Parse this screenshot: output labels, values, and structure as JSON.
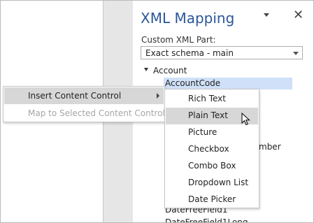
{
  "pane": {
    "title": "XML Mapping",
    "field_label": "Custom XML Part:",
    "selected_part": "Exact schema - main"
  },
  "tree": {
    "root": "Account",
    "selected": "AccountCode",
    "partial_member": "mber",
    "item_a": "DateFreeField1",
    "item_b": "DateFreeField1Long"
  },
  "context_menu": {
    "insert_label": "Insert Content Control",
    "map_label": "Map to Selected Content Control"
  },
  "submenu": {
    "items": [
      "Rich Text",
      "Plain Text",
      "Picture",
      "Checkbox",
      "Combo Box",
      "Dropdown List",
      "Date Picker"
    ],
    "highlighted": "Plain Text"
  }
}
